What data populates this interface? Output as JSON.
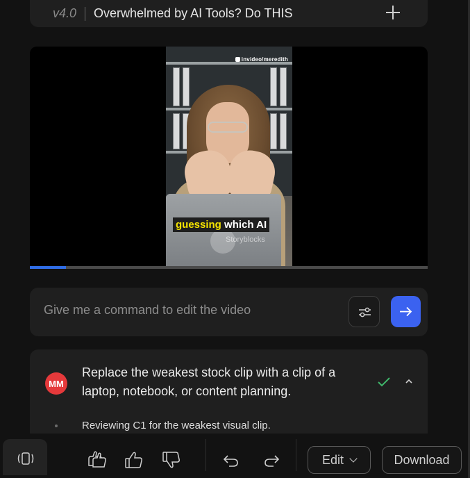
{
  "header": {
    "version": "v4.0",
    "title": "Overwhelmed by AI Tools? Do THIS",
    "add_icon": "plus-icon"
  },
  "video": {
    "watermark": "invideo/meredith",
    "caption_highlight": "guessing",
    "caption_rest": " which AI",
    "stock_watermark": "Storyblocks",
    "progress_fraction": 0.09
  },
  "command": {
    "placeholder": "Give me a command to edit the video",
    "settings_icon": "sliders-icon",
    "send_icon": "arrow-right-icon",
    "accent": "#3b62f0"
  },
  "message": {
    "avatar_initials": "MM",
    "avatar_color": "#e5393b",
    "text": "Replace the weakest stock clip with a clip of a laptop, notebook, or content planning.",
    "status_icon": "check-icon",
    "status_color": "#3fb56a",
    "collapse_icon": "chevron-up-icon",
    "step_text": "Reviewing C1 for the weakest visual clip."
  },
  "toolbar": {
    "layout_icon": "layout-toggle-icon",
    "clap_icon": "clapping-hands-icon",
    "like_icon": "thumbs-up-icon",
    "dislike_icon": "thumbs-down-icon",
    "undo_icon": "undo-icon",
    "redo_icon": "redo-icon",
    "edit_label": "Edit",
    "download_label": "Download"
  }
}
